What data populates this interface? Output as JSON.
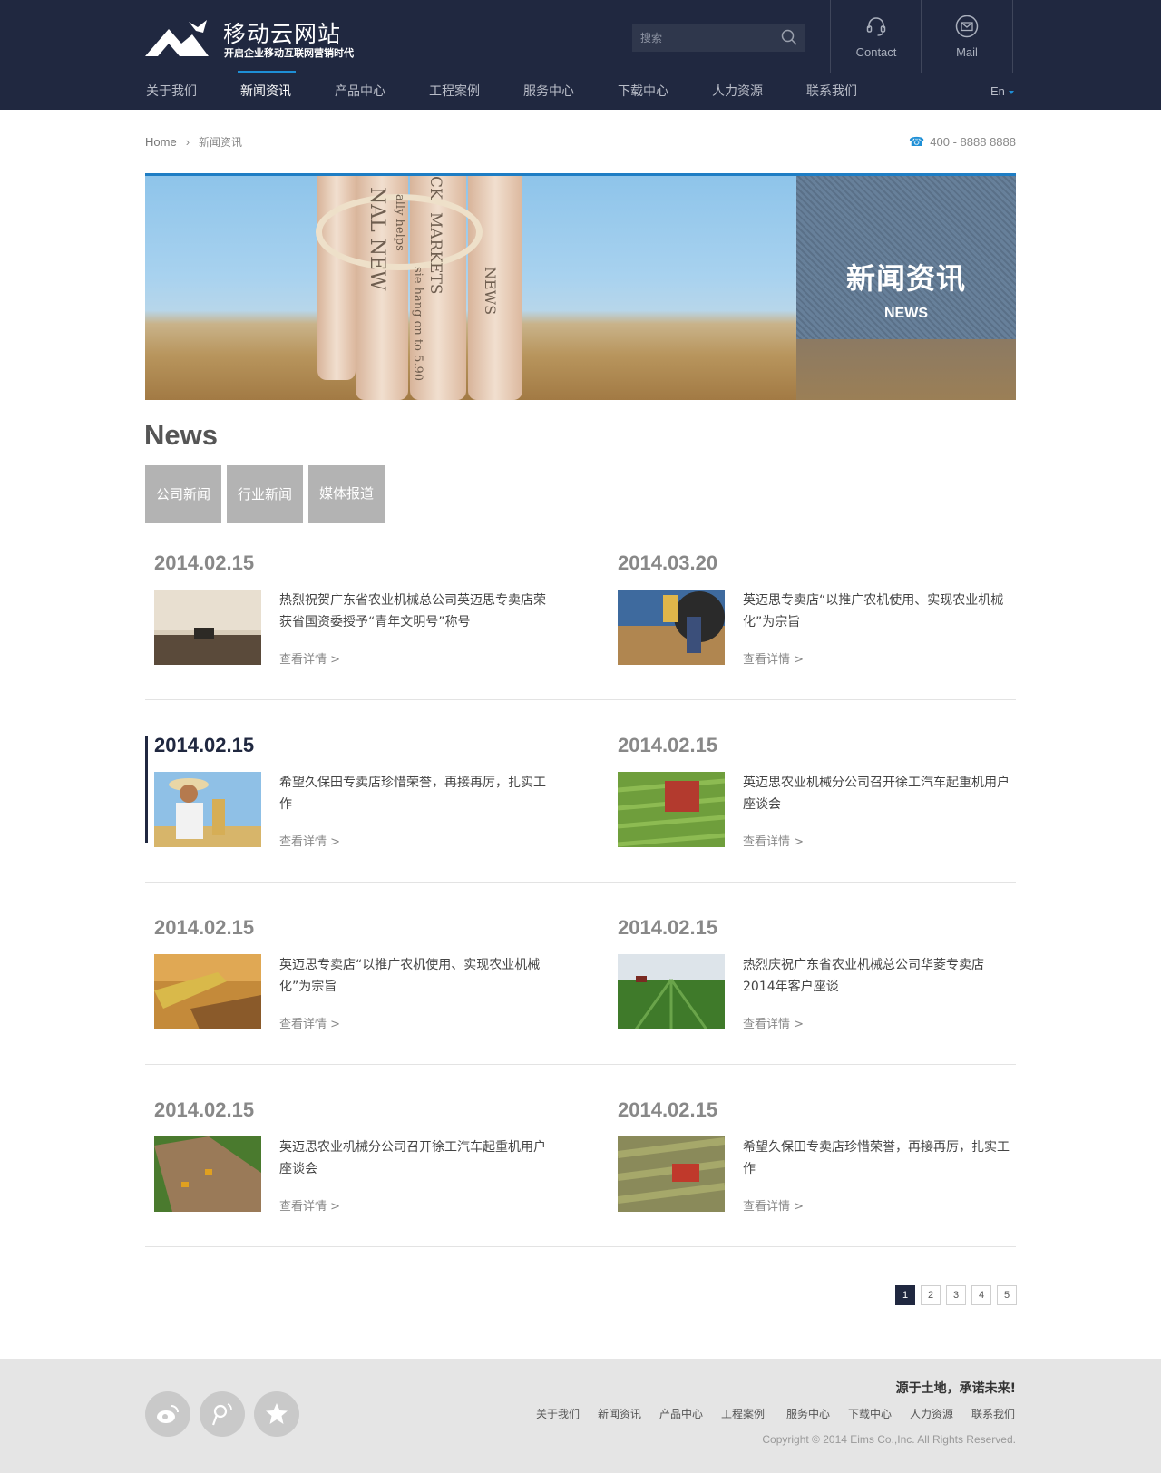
{
  "brand": {
    "name": "移动云网站",
    "tagline": "开启企业移动互联网营销时代",
    "logo_icon": "mountain-bird-logo"
  },
  "search": {
    "placeholder": "搜索",
    "icon": "search-icon"
  },
  "tools": [
    {
      "label": "Contact",
      "icon": "headset-icon"
    },
    {
      "label": "Mail",
      "icon": "mail-icon"
    }
  ],
  "nav": {
    "items": [
      "关于我们",
      "新闻资讯",
      "产品中心",
      "工程案例",
      "服务中心",
      "下载中心",
      "人力资源",
      "联系我们"
    ],
    "active": "新闻资讯",
    "lang": "En"
  },
  "breadcrumb": {
    "home": "Home",
    "current": "新闻资讯"
  },
  "phone": "400 - 8888 8888",
  "banner": {
    "title": "新闻资讯",
    "subtitle": "NEWS",
    "paper_words": [
      "NAL NEW",
      "MARKETS",
      "sie hang on to 5.90",
      "NEWS",
      "ally helps",
      "CK"
    ]
  },
  "news": {
    "heading": "News",
    "tabs": [
      "公司新闻",
      "行业新闻",
      "媒体报道"
    ],
    "more_label": "查看详情 >",
    "items": [
      {
        "date": "2014.02.15",
        "title": "热烈祝贺广东省农业机械总公司英迈思专卖店荣获省国资委授予“青年文明号”称号"
      },
      {
        "date": "2014.03.20",
        "title": "英迈思专卖店“以推广农机使用、实现农业机械化”为宗旨"
      },
      {
        "date": "2014.02.15",
        "title": "希望久保田专卖店珍惜荣誉，再接再厉，扎实工作"
      },
      {
        "date": "2014.02.15",
        "title": "英迈思农业机械分公司召开徐工汽车起重机用户座谈会"
      },
      {
        "date": "2014.02.15",
        "title": "英迈思专卖店“以推广农机使用、实现农业机械化”为宗旨"
      },
      {
        "date": "2014.02.15",
        "title": "热烈庆祝广东省农业机械总公司华菱专卖店2014年客户座谈"
      },
      {
        "date": "2014.02.15",
        "title": "英迈思农业机械分公司召开徐工汽车起重机用户座谈会"
      },
      {
        "date": "2014.02.15",
        "title": "希望久保田专卖店珍惜荣誉，再接再厉，扎实工作"
      }
    ]
  },
  "pagination": {
    "pages": [
      "1",
      "2",
      "3",
      "4",
      "5"
    ],
    "current": "1"
  },
  "footer": {
    "slogan": "源于土地，承诺未来!",
    "links": [
      "关于我们",
      "新闻资讯",
      "产品中心",
      "工程案例",
      "服务中心",
      "下载中心",
      "人力资源",
      "联系我们"
    ],
    "copyright": "Copyright © 2014  Eims Co.,Inc. All Rights Reserved.",
    "social_icons": [
      "weibo-icon",
      "tencent-weibo-icon",
      "favorite-star-icon"
    ]
  },
  "colors": {
    "header_bg": "#202840",
    "accent": "#1e8fd6",
    "tab_bg": "#b3b3b3",
    "footer_bg": "#e5e5e5"
  }
}
